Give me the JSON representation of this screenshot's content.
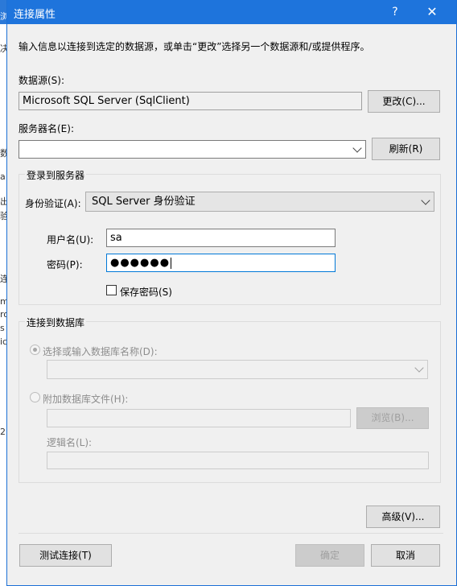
{
  "dialog": {
    "title": "连接属性",
    "help_label": "?",
    "close_label": "✕"
  },
  "intro_text": "输入信息以连接到选定的数据源，或单击“更改”选择另一个数据源和/或提供程序。",
  "datasource": {
    "label": "数据源(S):",
    "value": "Microsoft SQL Server (SqlClient)",
    "change_button": "更改(C)..."
  },
  "server": {
    "label": "服务器名(E):",
    "value": "",
    "refresh_button": "刷新(R)"
  },
  "login": {
    "group_label": "登录到服务器",
    "auth_label": "身份验证(A):",
    "auth_value": "SQL Server 身份验证",
    "username_label": "用户名(U):",
    "username_value": "sa",
    "password_label": "密码(P):",
    "password_mask": "●●●●●●",
    "save_password_label": "保存密码(S)",
    "save_password_checked": false
  },
  "database": {
    "group_label": "连接到数据库",
    "select_option_label": "选择或输入数据库名称(D):",
    "select_value": "",
    "attach_option_label": "附加数据库文件(H):",
    "attach_value": "",
    "browse_button": "浏览(B)...",
    "logical_name_label": "逻辑名(L):",
    "logical_name_value": ""
  },
  "footer": {
    "advanced_button": "高级(V)...",
    "test_button": "测试连接(T)",
    "ok_button": "确定",
    "cancel_button": "取消"
  },
  "background_fragments": [
    "浏",
    "决",
    "数",
    "a",
    "出",
    "验",
    "连",
    "m",
    "ro",
    "s",
    "ic",
    "2"
  ],
  "colors": {
    "titlebar": "#1e74dc",
    "focus_border": "#0078d7",
    "dialog_bg": "#f0f0f0"
  }
}
